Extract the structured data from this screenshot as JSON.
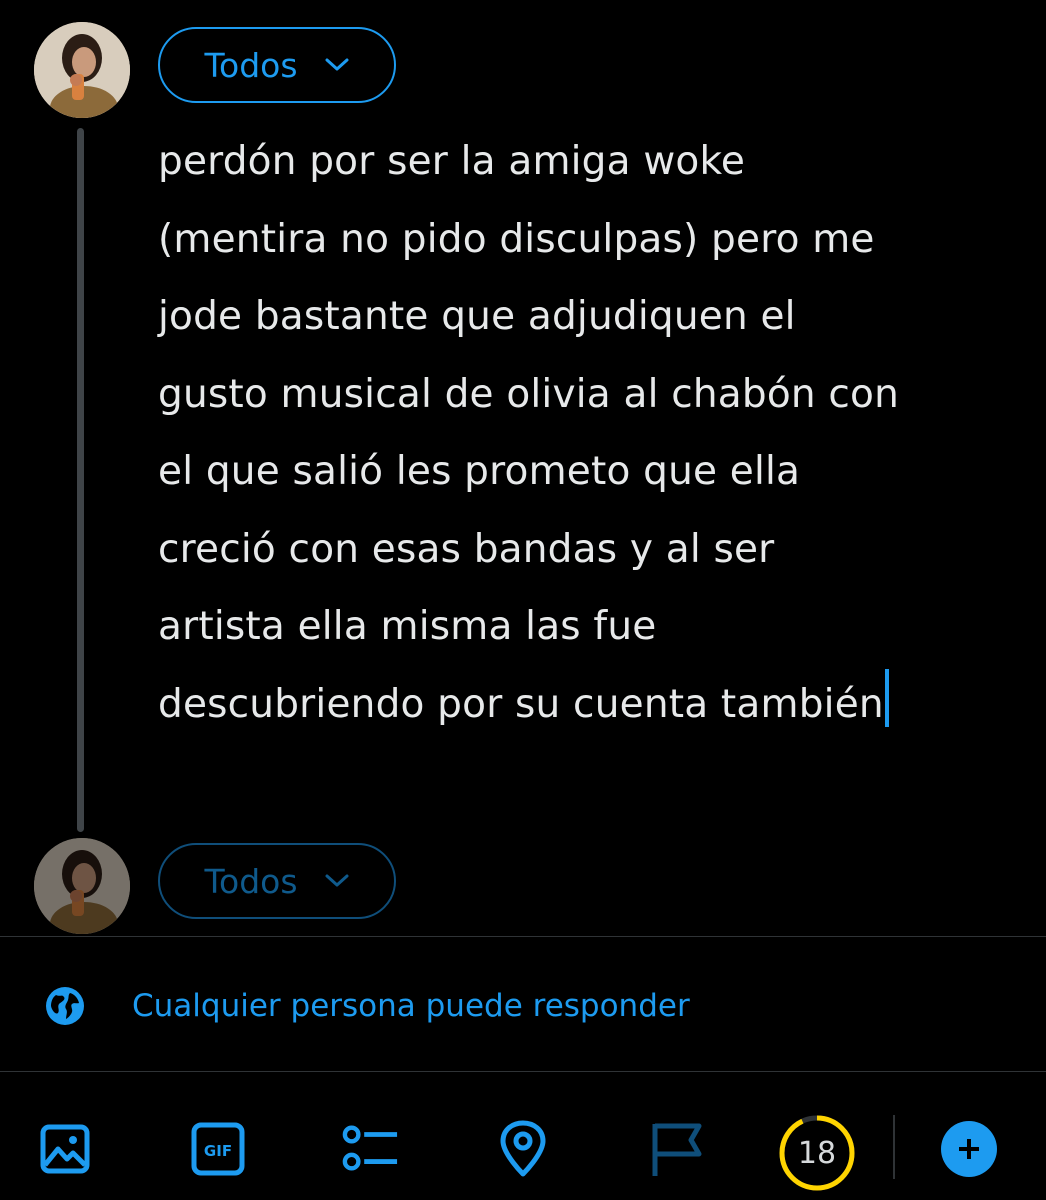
{
  "composer": {
    "audience_label": "Todos",
    "tweet_text": "perdón por ser la amiga woke\n(mentira no pido disculpas) pero me\njode bastante que adjudiquen el\ngusto musical de olivia al chabón con\nel que salió les prometo que ella\ncreció con esas bandas y al ser\nartista ella misma las fue\ndescubriendo por su cuenta también",
    "next_audience_label": "Todos"
  },
  "reply_setting": {
    "label": "Cualquier persona puede responder",
    "icon": "globe-icon"
  },
  "toolbar": {
    "icons": [
      "image-icon",
      "gif-icon",
      "poll-icon",
      "location-icon",
      "flag-icon"
    ],
    "char_count_remaining": "18",
    "char_progress_fraction": 0.93,
    "add_icon": "plus-icon"
  },
  "colors": {
    "accent": "#1d9bf0",
    "background": "#000000",
    "text": "#e7e9ea",
    "warning_ring": "#ffd400",
    "divider": "#2f3336"
  }
}
